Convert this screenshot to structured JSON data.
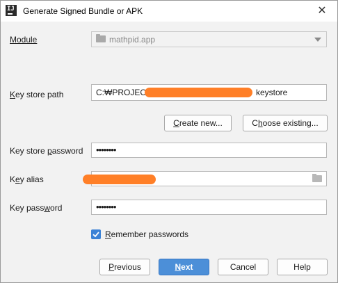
{
  "window": {
    "title": "Generate Signed Bundle or APK",
    "app_icon_text": "IJ",
    "close_symbol": "✕"
  },
  "form": {
    "module": {
      "label": "Module",
      "value": "mathpid.app",
      "icon": "folder-icon"
    },
    "key_store_path": {
      "label": "Key store path",
      "value_prefix": "C:₩PROJECT₩",
      "value_suffix": "keystore",
      "redacted": true
    },
    "create_new_label": "Create new...",
    "choose_existing_label": "Choose existing...",
    "key_store_password": {
      "label": "Key store password",
      "value": "••••••••"
    },
    "key_alias": {
      "label": "Key alias",
      "redacted": true,
      "icon": "folder-icon"
    },
    "key_password": {
      "label": "Key password",
      "value": "••••••••"
    },
    "remember_passwords": {
      "label": "Remember passwords",
      "checked": true
    }
  },
  "footer": {
    "previous_label": "Previous",
    "next_label": "Next",
    "cancel_label": "Cancel",
    "help_label": "Help"
  },
  "colors": {
    "primary_button": "#4c8fd8",
    "checkbox": "#3b82d6",
    "redaction": "#ff7f27"
  }
}
